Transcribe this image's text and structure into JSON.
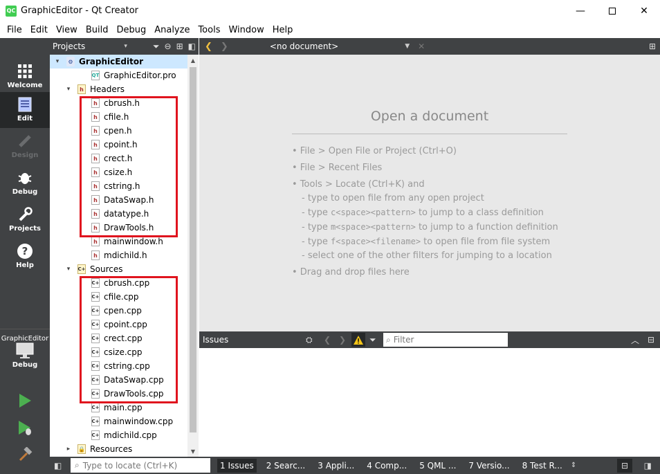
{
  "window": {
    "title": "GraphicEditor - Qt Creator",
    "logo": "QC"
  },
  "menu": [
    "File",
    "Edit",
    "View",
    "Build",
    "Debug",
    "Analyze",
    "Tools",
    "Window",
    "Help"
  ],
  "modes": {
    "welcome": "Welcome",
    "edit": "Edit",
    "design": "Design",
    "debug": "Debug",
    "projects": "Projects",
    "help": "Help"
  },
  "kit": {
    "name": "GraphicEditor",
    "label": "Debug"
  },
  "projects_pane": {
    "title": "Projects"
  },
  "tree": {
    "project": "GraphicEditor",
    "pro_file": "GraphicEditor.pro",
    "headers_folder": "Headers",
    "headers": [
      "cbrush.h",
      "cfile.h",
      "cpen.h",
      "cpoint.h",
      "crect.h",
      "csize.h",
      "cstring.h",
      "DataSwap.h",
      "datatype.h",
      "DrawTools.h",
      "mainwindow.h",
      "mdichild.h"
    ],
    "sources_folder": "Sources",
    "sources": [
      "cbrush.cpp",
      "cfile.cpp",
      "cpen.cpp",
      "cpoint.cpp",
      "crect.cpp",
      "csize.cpp",
      "cstring.cpp",
      "DataSwap.cpp",
      "DrawTools.cpp",
      "main.cpp",
      "mainwindow.cpp",
      "mdichild.cpp"
    ],
    "resources_folder": "Resources"
  },
  "editor": {
    "document": "<no document>",
    "heading": "Open a document",
    "tips": {
      "t1": "• File > Open File or Project (Ctrl+O)",
      "t2": "• File > Recent Files",
      "t3": "• Tools > Locate (Ctrl+K) and",
      "s1": "- type to open file from any open project",
      "s2a": "- type ",
      "s2b": "c<space><pattern>",
      "s2c": " to jump to a class definition",
      "s3a": "- type ",
      "s3b": "m<space><pattern>",
      "s3c": " to jump to a function definition",
      "s4a": "- type ",
      "s4b": "f<space><filename>",
      "s4c": " to open file from file system",
      "s5": "- select one of the other filters for jumping to a location",
      "t4": "• Drag and drop files here"
    }
  },
  "issues": {
    "title": "Issues",
    "filter_placeholder": "Filter"
  },
  "status": {
    "locator_placeholder": "Type to locate (Ctrl+K)",
    "tabs": [
      "1  Issues",
      "2  Searc...",
      "3  Appli...",
      "4  Comp...",
      "5  QML ...",
      "7  Versio...",
      "8  Test R..."
    ]
  }
}
